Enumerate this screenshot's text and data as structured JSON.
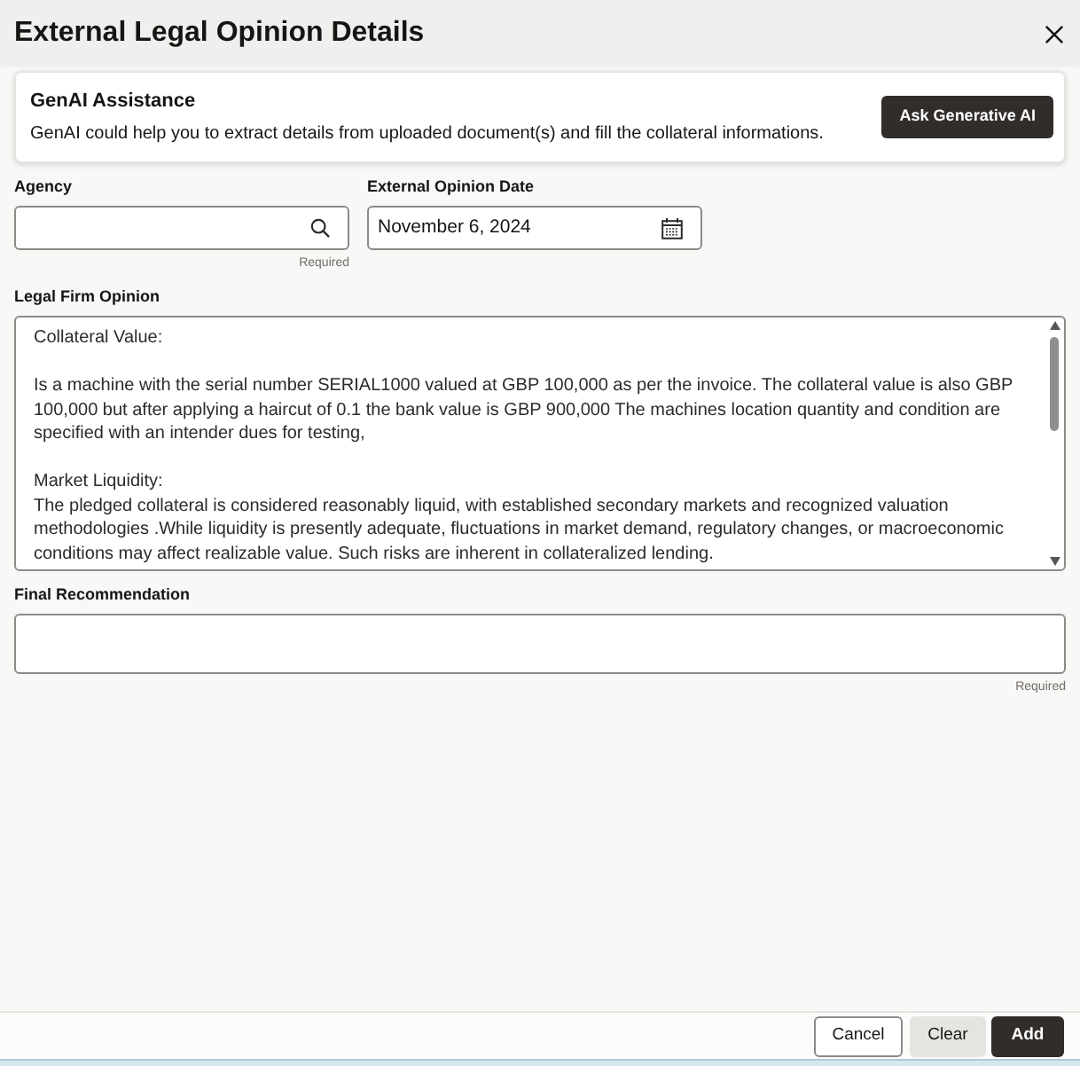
{
  "dialog": {
    "title": "External Legal Opinion Details"
  },
  "genai_assistance": {
    "title": "GenAI Assistance",
    "description": "GenAI could help you to extract details from uploaded document(s) and fill the collateral informations.",
    "button": "Ask Generative AI"
  },
  "fields": [
    {
      "kind": "search",
      "label": "Agency",
      "helper": "Required"
    },
    {
      "kind": "date",
      "label": "External Opinion Date",
      "value": "November 6, 2024"
    }
  ],
  "legal_firm_opinion": {
    "label": "Legal Firm Opinion",
    "value": "Collateral Value:\n\nIs a machine with the serial number SERIAL1000 valued at GBP 100,000 as per the invoice. The collateral value is also GBP 100,000 but after applying a haircut of 0.1 the bank value is GBP 900,000 The machines location quantity and condition are specified with an intender dues for testing,\n\nMarket Liquidity:\nThe pledged collateral is considered reasonably liquid, with established secondary markets and recognized valuation methodologies .While liquidity is presently adequate, fluctuations in market demand, regulatory changes, or macroeconomic conditions may affect realizable value. Such risks are inherent in collateralized lending."
  },
  "final_recommendation": {
    "label": "Final Recommendation",
    "helper": "Required"
  },
  "buttons": [
    {
      "label": "Cancel",
      "kind": "outline"
    },
    {
      "label": "Clear",
      "kind": "secondary"
    },
    {
      "label": "Add",
      "kind": "primary"
    }
  ]
}
